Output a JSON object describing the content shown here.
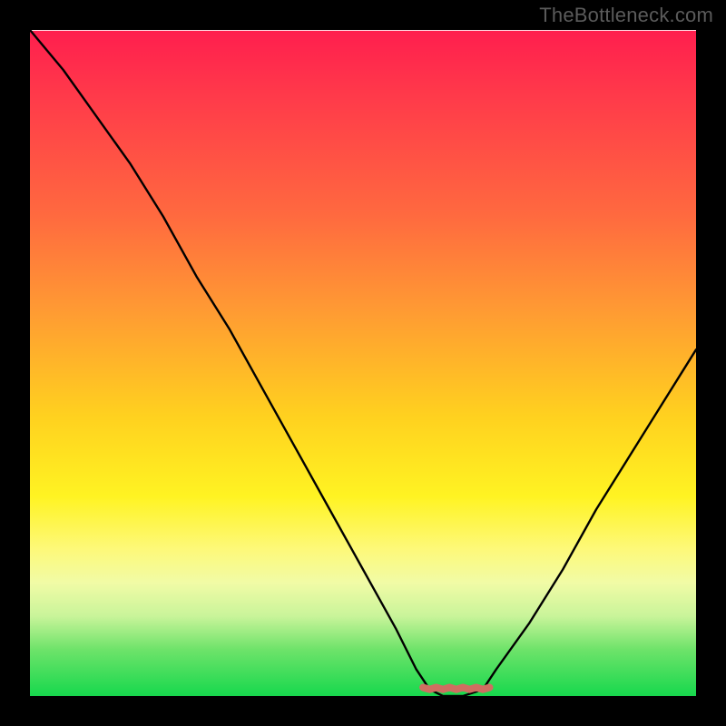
{
  "watermark": "TheBottleneck.com",
  "chart_data": {
    "type": "line",
    "title": "",
    "xlabel": "",
    "ylabel": "",
    "xlim": [
      0,
      100
    ],
    "ylim": [
      0,
      100
    ],
    "series": [
      {
        "name": "bottleneck-curve",
        "x": [
          0,
          5,
          10,
          15,
          20,
          25,
          30,
          35,
          40,
          45,
          50,
          55,
          58,
          60,
          62,
          65,
          68,
          70,
          75,
          80,
          85,
          90,
          95,
          100
        ],
        "values": [
          100,
          94,
          87,
          80,
          72,
          63,
          55,
          46,
          37,
          28,
          19,
          10,
          4,
          1,
          0,
          0,
          1,
          4,
          11,
          19,
          28,
          36,
          44,
          52
        ]
      },
      {
        "name": "flat-segment",
        "x": [
          59,
          60,
          61,
          62,
          63,
          64,
          65,
          66,
          67,
          68,
          69
        ],
        "values": [
          1.3,
          1.0,
          1.3,
          1.0,
          1.3,
          1.0,
          1.3,
          1.0,
          1.3,
          1.0,
          1.3
        ]
      }
    ],
    "background_gradient_stops": [
      {
        "pos": 0,
        "color": "#ff1e4e"
      },
      {
        "pos": 10,
        "color": "#ff3a4a"
      },
      {
        "pos": 28,
        "color": "#ff6a3f"
      },
      {
        "pos": 42,
        "color": "#ff9a33"
      },
      {
        "pos": 58,
        "color": "#ffd11f"
      },
      {
        "pos": 70,
        "color": "#fff322"
      },
      {
        "pos": 78,
        "color": "#fdf97a"
      },
      {
        "pos": 83,
        "color": "#f1fba6"
      },
      {
        "pos": 88,
        "color": "#c9f49a"
      },
      {
        "pos": 93,
        "color": "#6ee36a"
      },
      {
        "pos": 100,
        "color": "#17d84d"
      }
    ],
    "gridline_y_positions_pct_from_top": [
      74,
      76.5,
      79,
      81.5,
      84,
      86.5,
      89,
      91.5,
      94,
      96.5
    ]
  },
  "colors": {
    "curve": "#000000",
    "flat_segment": "#cf6e61",
    "frame": "#000000",
    "watermark": "#5b5b5b"
  }
}
